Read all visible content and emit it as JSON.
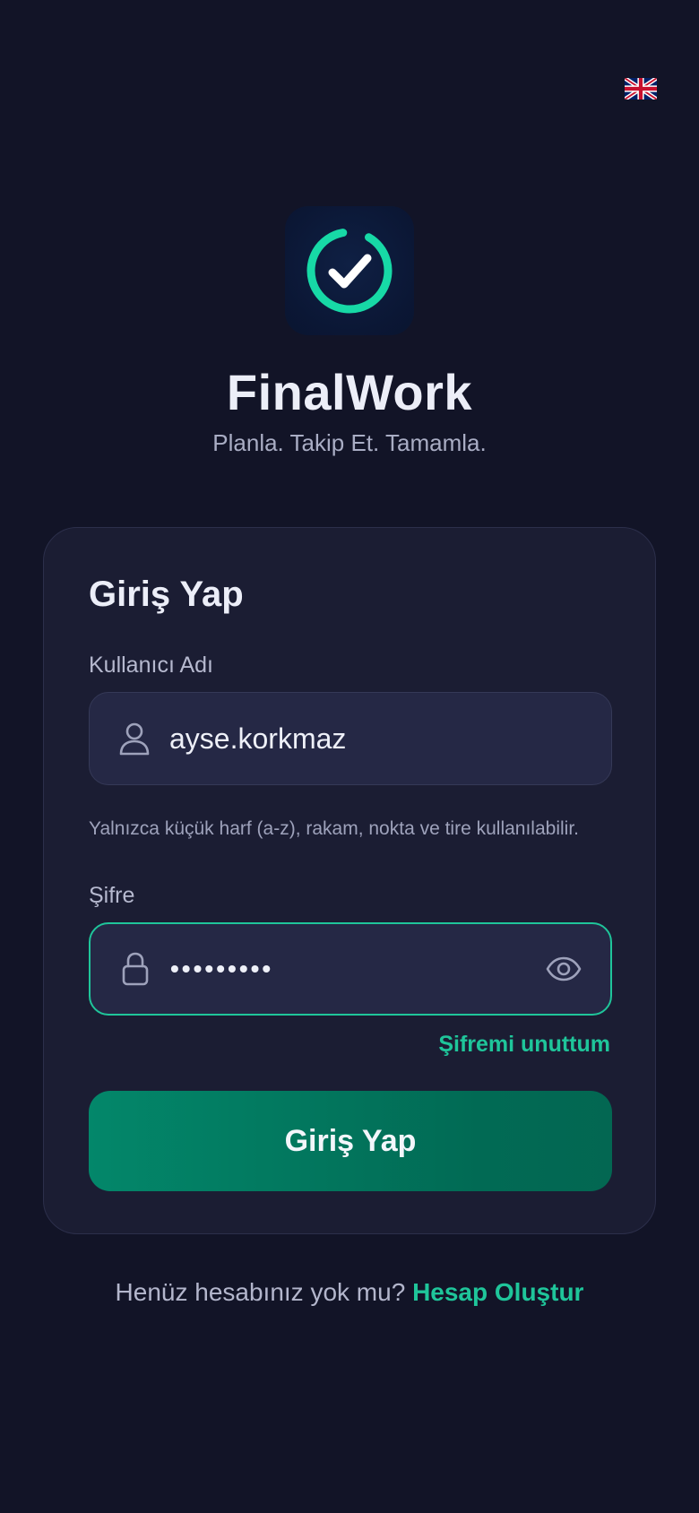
{
  "header": {
    "language_icon": "uk-flag-icon"
  },
  "brand": {
    "logo_icon": "check-circle-icon",
    "title": "FinalWork",
    "tagline": "Planla. Takip Et. Tamamla."
  },
  "login_card": {
    "title": "Giriş Yap",
    "username": {
      "label": "Kullanıcı Adı",
      "value": "ayse.korkmaz",
      "icon": "user-icon",
      "hint": "Yalnızca küçük harf (a-z), rakam, nokta ve tire kullanılabilir."
    },
    "password": {
      "label": "Şifre",
      "masked_value": "•••••••••",
      "icon": "lock-icon",
      "toggle_icon": "eye-icon"
    },
    "forgot_password": "Şifremi unuttum",
    "submit_label": "Giriş Yap"
  },
  "signup": {
    "prompt": "Henüz hesabınız yok mu?",
    "link": "Hesap Oluştur"
  },
  "colors": {
    "background": "#121427",
    "card": "#1b1d33",
    "accent": "#1fc59a",
    "button": "#03876a"
  }
}
